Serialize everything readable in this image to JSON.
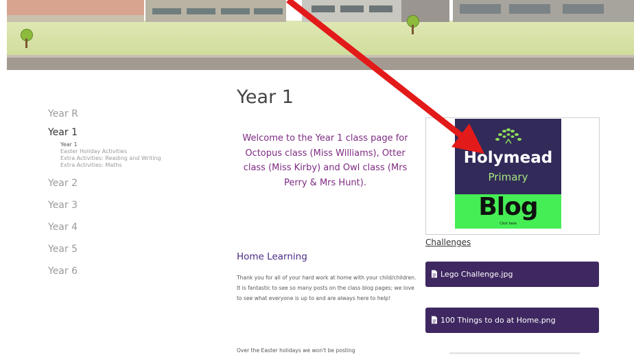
{
  "sidebar": {
    "items": [
      {
        "label": "Year R"
      },
      {
        "label": "Year 1",
        "active": true,
        "subitems": [
          {
            "label": "Year 1"
          },
          {
            "label": "Easter Holiday Activities"
          },
          {
            "label": "Extra Activities: Reading and Writing"
          },
          {
            "label": "Extra Activities: Maths"
          }
        ]
      },
      {
        "label": "Year 2"
      },
      {
        "label": "Year 3"
      },
      {
        "label": "Year 4"
      },
      {
        "label": "Year 5"
      },
      {
        "label": "Year 6"
      }
    ]
  },
  "main": {
    "title": "Year 1",
    "welcome": "Welcome to the Year 1 class page for Octopus class (Miss Williams), Otter class (Miss Kirby) and Owl class (Mrs Perry & Mrs Hunt).",
    "section_title": "Home Learning",
    "paragraph1": "Thank you for all of your hard work at home with your child/children. It is fantastic to see so many posts on the class blog pages; we love to see what everyone is up to and are always here to help!",
    "paragraph2": "Over the Easter holidays we won't be posting"
  },
  "right": {
    "blog_logo": {
      "brand": "Holymead",
      "sub": "Primary",
      "word": "Blog",
      "click": "Click here"
    },
    "challenges_link": "Challenges",
    "files": [
      {
        "label": "Lego Challenge.jpg"
      },
      {
        "label": "100 Things to do at Home.png"
      }
    ]
  },
  "colors": {
    "accent_purple": "#3f2861",
    "welcome_text": "#7d2a82",
    "arrow_red": "#e31a1a",
    "logo_bg": "#322a59",
    "logo_green": "#45ee55"
  },
  "icons": [
    "file-icon",
    "leaf-logo-icon",
    "red-arrow-annotation"
  ]
}
